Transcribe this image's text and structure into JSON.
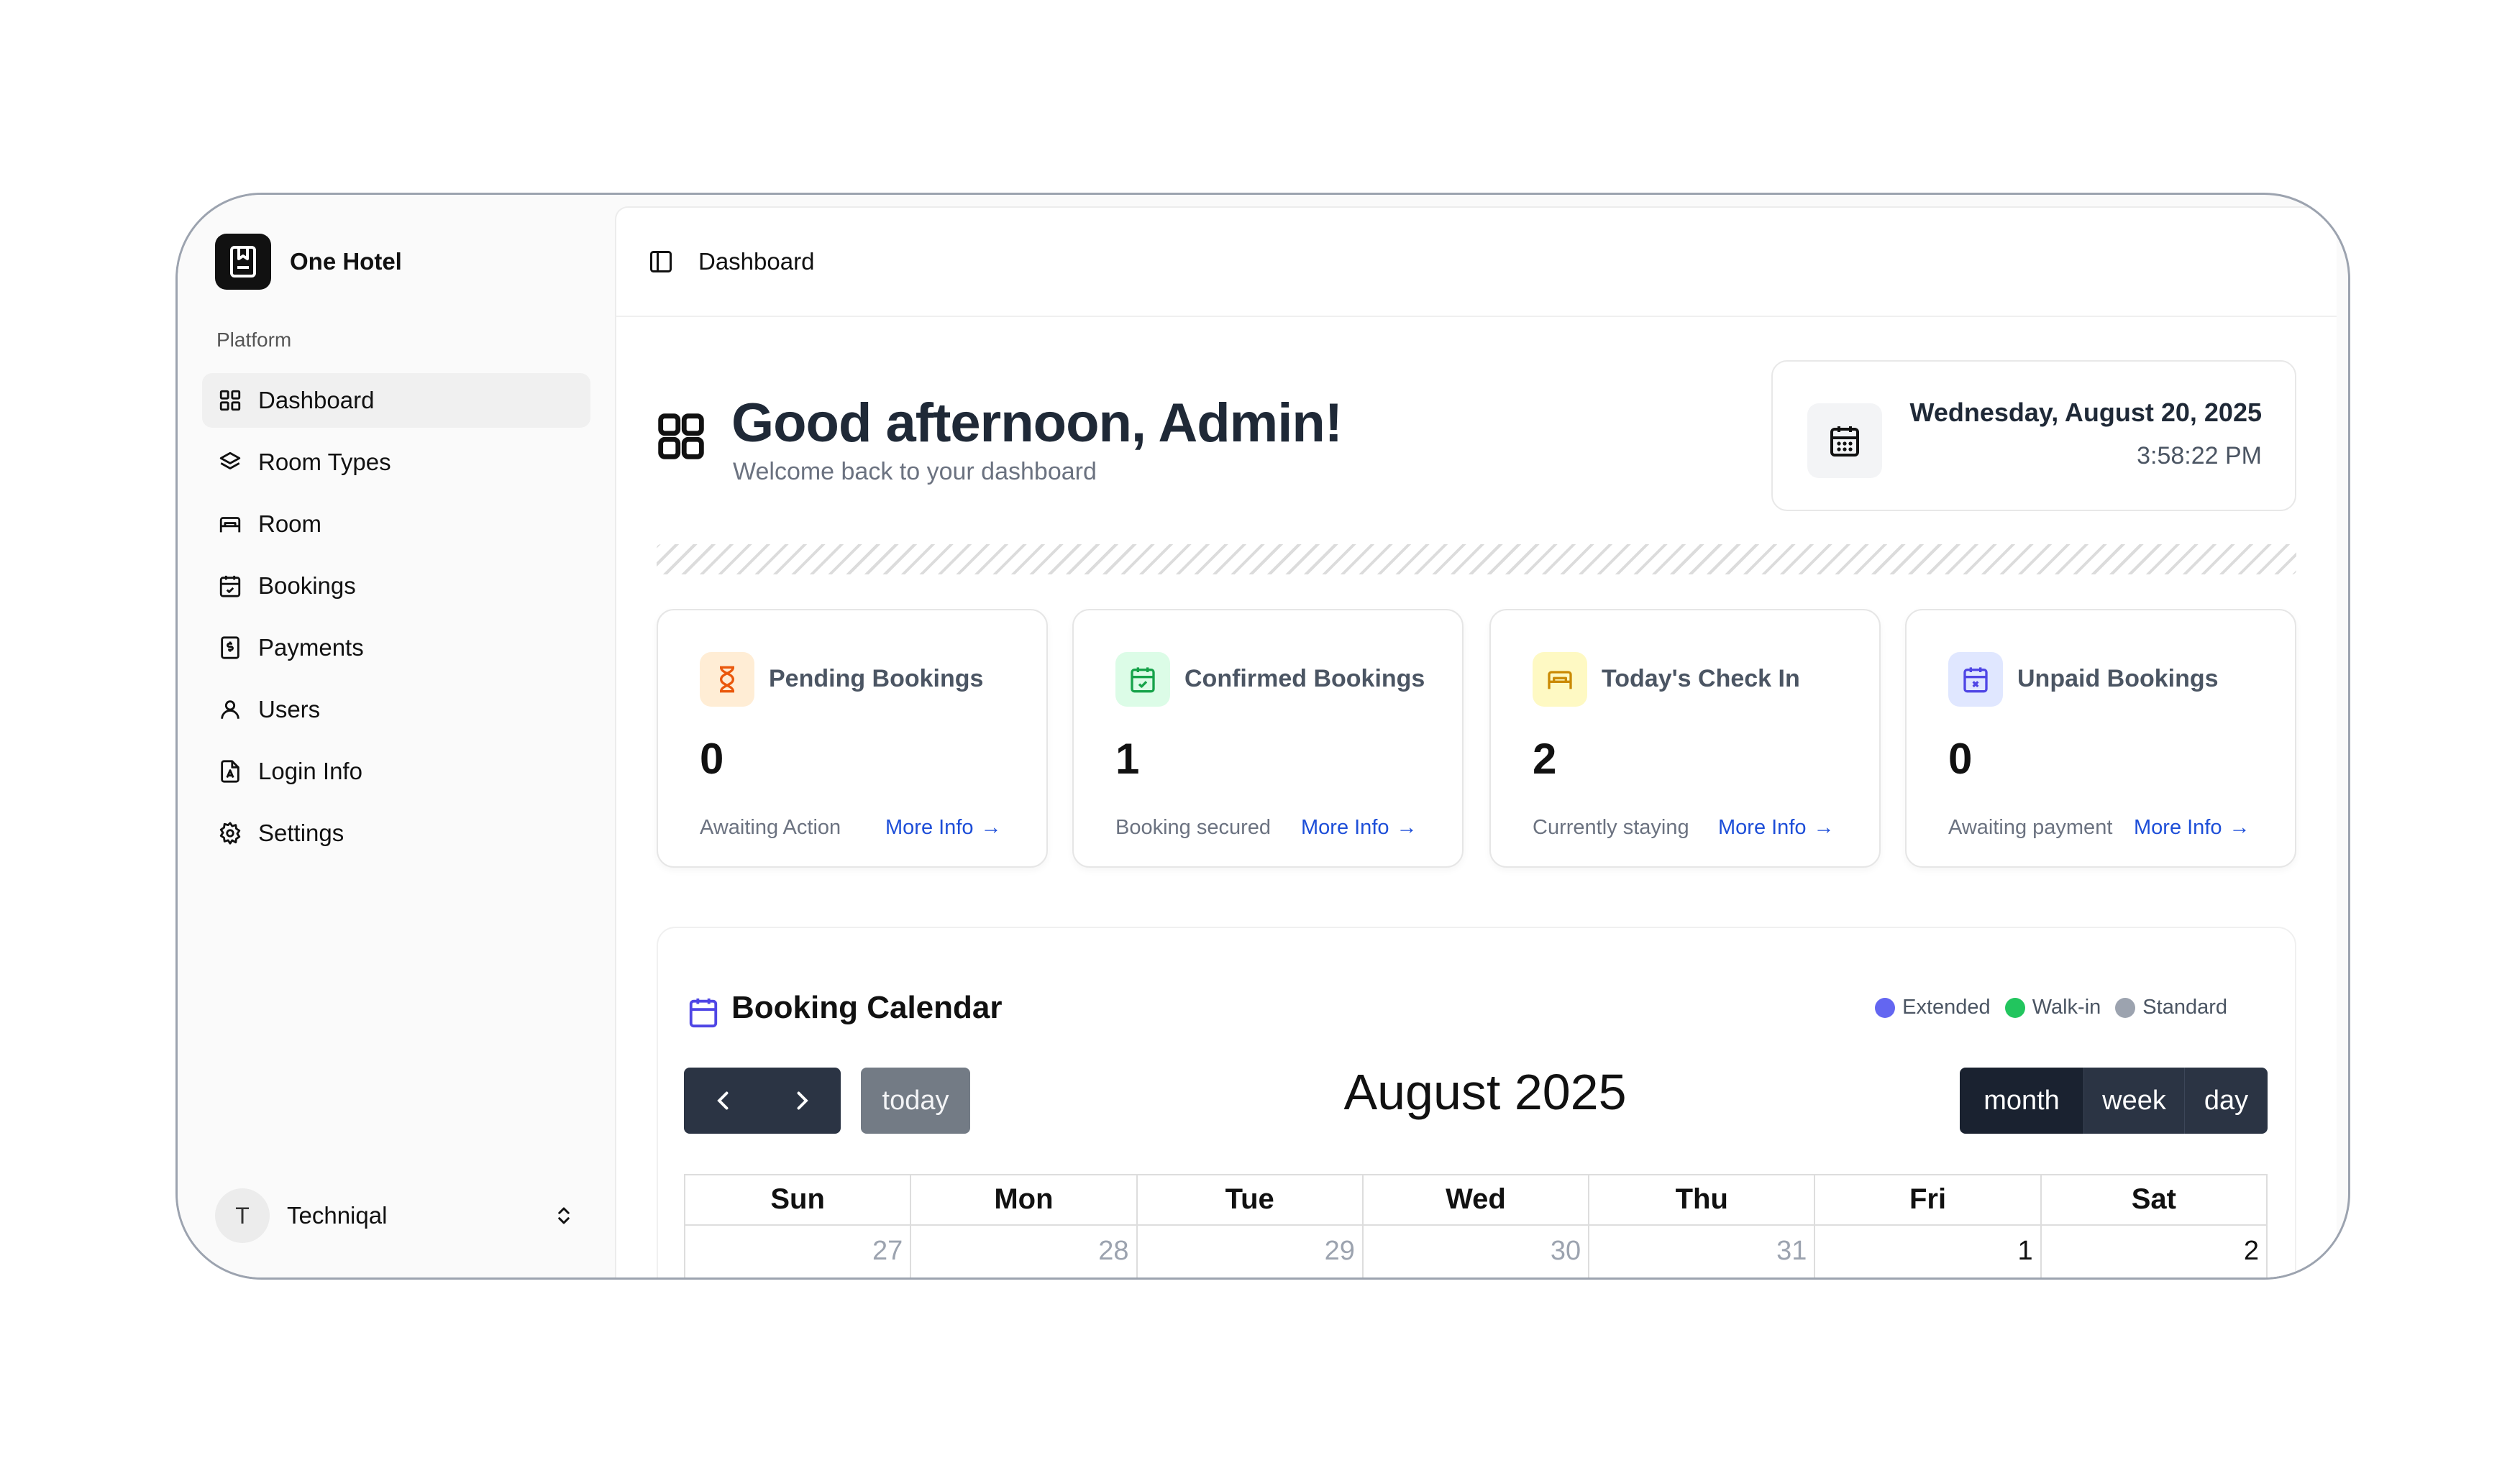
{
  "app": {
    "name": "One Hotel"
  },
  "sidebar": {
    "group_label": "Platform",
    "items": [
      {
        "label": "Dashboard",
        "icon": "grid-icon",
        "active": true
      },
      {
        "label": "Room Types",
        "icon": "layers-icon"
      },
      {
        "label": "Room",
        "icon": "bed-icon"
      },
      {
        "label": "Bookings",
        "icon": "calendar-check-icon"
      },
      {
        "label": "Payments",
        "icon": "receipt-icon"
      },
      {
        "label": "Users",
        "icon": "user-icon"
      },
      {
        "label": "Login Info",
        "icon": "file-user-icon"
      },
      {
        "label": "Settings",
        "icon": "gear-icon"
      }
    ],
    "user": {
      "initial": "T",
      "name": "Techniqal"
    }
  },
  "header": {
    "breadcrumb": "Dashboard"
  },
  "greeting": {
    "title": "Good afternoon, Admin!",
    "subtitle": "Welcome back to your dashboard"
  },
  "datetime": {
    "date": "Wednesday, August 20, 2025",
    "time": "3:58:22 PM"
  },
  "stats": [
    {
      "label": "Pending Bookings",
      "value": "0",
      "caption": "Awaiting Action",
      "more": "More Info",
      "icon": "hourglass-icon",
      "color": "#ea580c",
      "bg": "#ffedd5"
    },
    {
      "label": "Confirmed Bookings",
      "value": "1",
      "caption": "Booking secured",
      "more": "More Info",
      "icon": "calendar-check-icon",
      "color": "#16a34a",
      "bg": "#dcfce7"
    },
    {
      "label": "Today's Check In",
      "value": "2",
      "caption": "Currently staying",
      "more": "More Info",
      "icon": "bed-icon",
      "color": "#ca8a04",
      "bg": "#fef9c3"
    },
    {
      "label": "Unpaid Bookings",
      "value": "0",
      "caption": "Awaiting payment",
      "more": "More Info",
      "icon": "calendar-x-icon",
      "color": "#4f46e5",
      "bg": "#e0e7ff"
    }
  ],
  "calendar": {
    "title": "Booking Calendar",
    "legend": [
      {
        "label": "Extended",
        "color": "#6366f1"
      },
      {
        "label": "Walk-in",
        "color": "#22c55e"
      },
      {
        "label": "Standard",
        "color": "#9ca3af"
      }
    ],
    "today_label": "today",
    "month_title": "August 2025",
    "views": {
      "month": "month",
      "week": "week",
      "day": "day",
      "active": "month"
    },
    "weekdays": [
      "Sun",
      "Mon",
      "Tue",
      "Wed",
      "Thu",
      "Fri",
      "Sat"
    ],
    "first_week": [
      "27",
      "28",
      "29",
      "30",
      "31",
      "1",
      "2"
    ]
  }
}
